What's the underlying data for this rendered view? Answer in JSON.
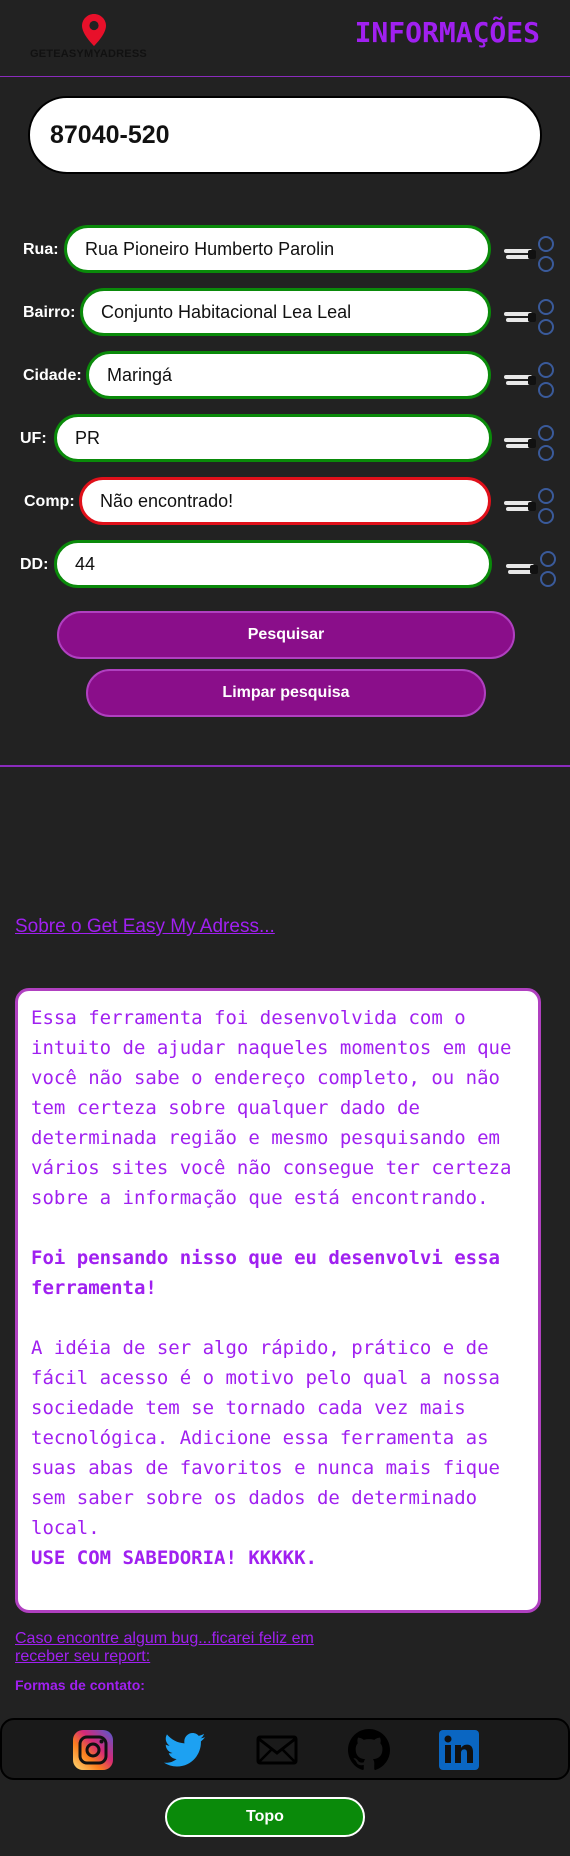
{
  "header": {
    "logo_text": "GETEASYMYADRESS",
    "title": "INFORMAÇÕES",
    "colors": {
      "accent": "#a020f0",
      "pin": "#e8102a"
    }
  },
  "search": {
    "cep_value": "87040-520"
  },
  "fields": [
    {
      "label": "Rua:",
      "value": "Rua Pioneiro Humberto Parolin",
      "status": "ok"
    },
    {
      "label": "Bairro:",
      "value": "Conjunto Habitacional Lea Leal",
      "status": "ok"
    },
    {
      "label": "Cidade:",
      "value": "Maringá",
      "status": "ok"
    },
    {
      "label": "UF:",
      "value": "PR",
      "status": "ok"
    },
    {
      "label": "Comp:",
      "value": "Não encontrado!",
      "status": "error"
    },
    {
      "label": "DD:",
      "value": "44",
      "status": "ok"
    }
  ],
  "copy_icon": "scissors-icon",
  "buttons": {
    "search": "Pesquisar",
    "clear": "Limpar pesquisa",
    "top": "Topo"
  },
  "about": {
    "link": "Sobre o Get Easy My Adress...",
    "p1": "Essa ferramenta foi desenvolvida com o intuito de ajudar naqueles momentos em que você não sabe o endereço completo, ou não tem certeza sobre qualquer dado de determinada região e mesmo pesquisando em vários sites você não consegue ter certeza sobre a informação que está encontrando.",
    "p2": "Foi pensando nisso que eu desenvolvi essa ferramenta!",
    "p3": "A idéia de ser algo rápido, prático e de fácil acesso é o motivo pelo qual a nossa sociedade tem se tornado cada vez mais tecnológica. Adicione essa ferramenta as suas abas de favoritos e nunca mais fique sem saber sobre os dados de determinado local.",
    "p4": "USE COM SABEDORIA! KKKKK."
  },
  "footer": {
    "bug_link": "Caso encontre algum bug...ficarei feliz em receber seu report:",
    "contact_label": "Formas de contato:",
    "social": [
      "instagram-icon",
      "twitter-icon",
      "mail-icon",
      "github-icon",
      "linkedin-icon"
    ]
  }
}
